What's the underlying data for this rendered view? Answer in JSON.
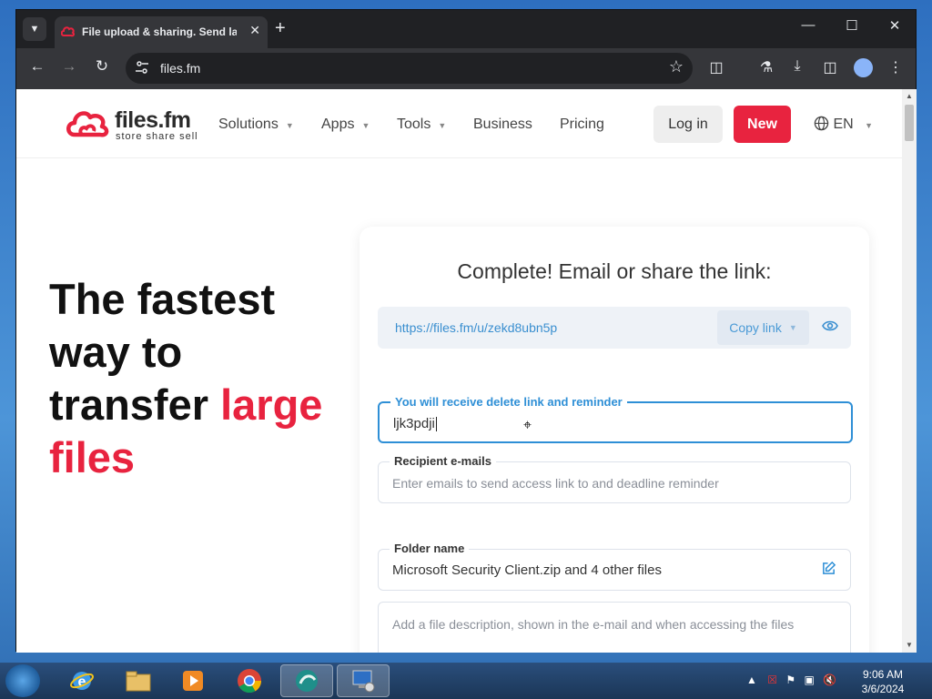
{
  "browser": {
    "tab_title": "File upload & sharing. Send large files",
    "url": "files.fm"
  },
  "site": {
    "logo_text": "files.fm",
    "logo_tagline": "store share sell",
    "nav": {
      "solutions": "Solutions",
      "apps": "Apps",
      "tools": "Tools",
      "business": "Business",
      "pricing": "Pricing"
    },
    "login": "Log in",
    "new": "New",
    "lang": "EN"
  },
  "hero": {
    "line1": "The fastest",
    "line2": "way to",
    "line3": "transfer",
    "accent1": "large",
    "accent2": "files"
  },
  "card": {
    "title": "Complete! Email or share the link:",
    "link": "https://files.fm/u/zekd8ubn5p",
    "copy_label": "Copy link",
    "email_label": "You will receive delete link and reminder",
    "email_value": "ljk3pdji",
    "recipient_label": "Recipient e-mails",
    "recipient_placeholder": "Enter emails to send access link to and deadline reminder",
    "folder_label": "Folder name",
    "folder_value": "Microsoft Security Client.zip and 4 other files",
    "description_placeholder": "Add a file description, shown in the e-mail and when accessing the files"
  },
  "taskbar": {
    "time": "9:06 AM",
    "date": "3/6/2024"
  },
  "colors": {
    "accent_red": "#e8233f",
    "link_blue": "#2e8fd6"
  }
}
